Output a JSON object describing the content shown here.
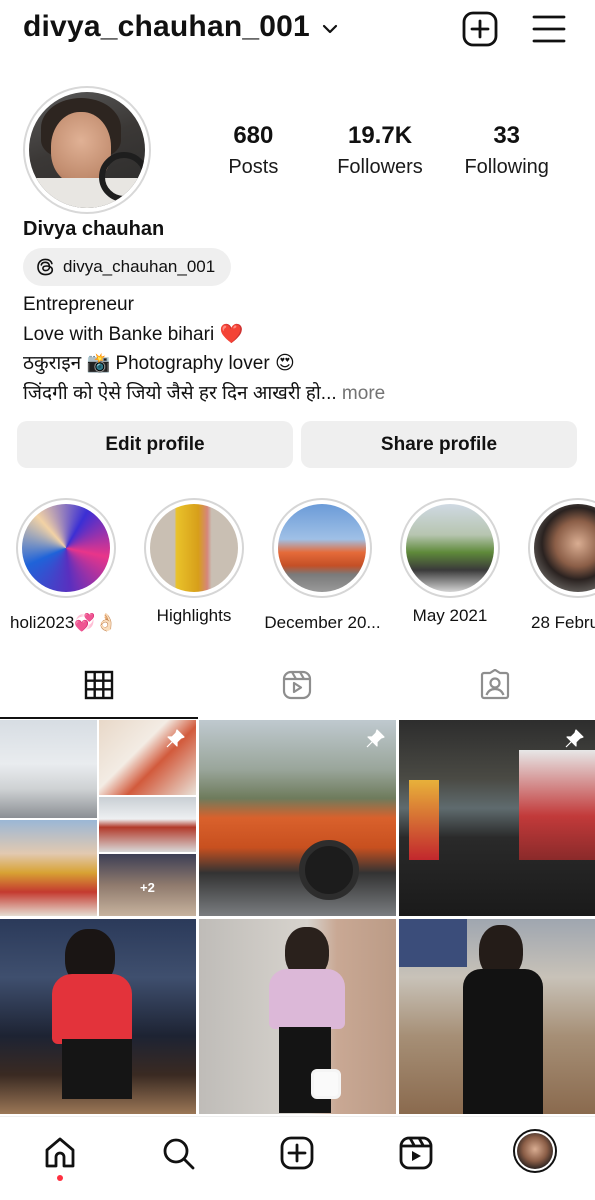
{
  "header": {
    "username": "divya_chauhan_001",
    "icons": [
      "chevron-down-icon",
      "create-post-icon",
      "menu-icon"
    ]
  },
  "profile": {
    "display_name": "Divya chauhan",
    "threads_handle": "divya_chauhan_001",
    "stats": [
      {
        "value": "680",
        "label": "Posts"
      },
      {
        "value": "19.7K",
        "label": "Followers"
      },
      {
        "value": "33",
        "label": "Following"
      }
    ],
    "bio": {
      "line1": "Entrepreneur",
      "line2": "Love with Banke bihari",
      "line2_emoji": "❤️",
      "line3": "ठकुराइन",
      "line3_emoji1": "📸",
      "line3_text2": "Photography lover",
      "line3_emoji2": "😍",
      "line4": "जिंदगी को ऐसे जियो जैसे हर दिन आखरी हो...",
      "more": "more"
    }
  },
  "actions": {
    "edit_profile": "Edit profile",
    "share_profile": "Share profile"
  },
  "highlights": [
    {
      "label": "holi2023💞👌🏻"
    },
    {
      "label": "Highlights"
    },
    {
      "label": "December 20..."
    },
    {
      "label": "May 2021"
    },
    {
      "label": "28 Febru"
    }
  ],
  "tabs": [
    {
      "name": "posts-grid",
      "icon": "grid-icon",
      "active": true
    },
    {
      "name": "reels",
      "icon": "reels-icon",
      "active": false
    },
    {
      "name": "tagged",
      "icon": "tagged-icon",
      "active": false
    }
  ],
  "grid": {
    "collage_badge": "+2",
    "pinned_count": 3
  },
  "bottom_nav": [
    "home-icon",
    "search-icon",
    "create-icon",
    "reels-icon",
    "profile-avatar"
  ],
  "colors": {
    "accent_red": "#ff3040",
    "heart": "#e0162b",
    "button_bg": "#efefef",
    "muted_text": "#737373"
  }
}
